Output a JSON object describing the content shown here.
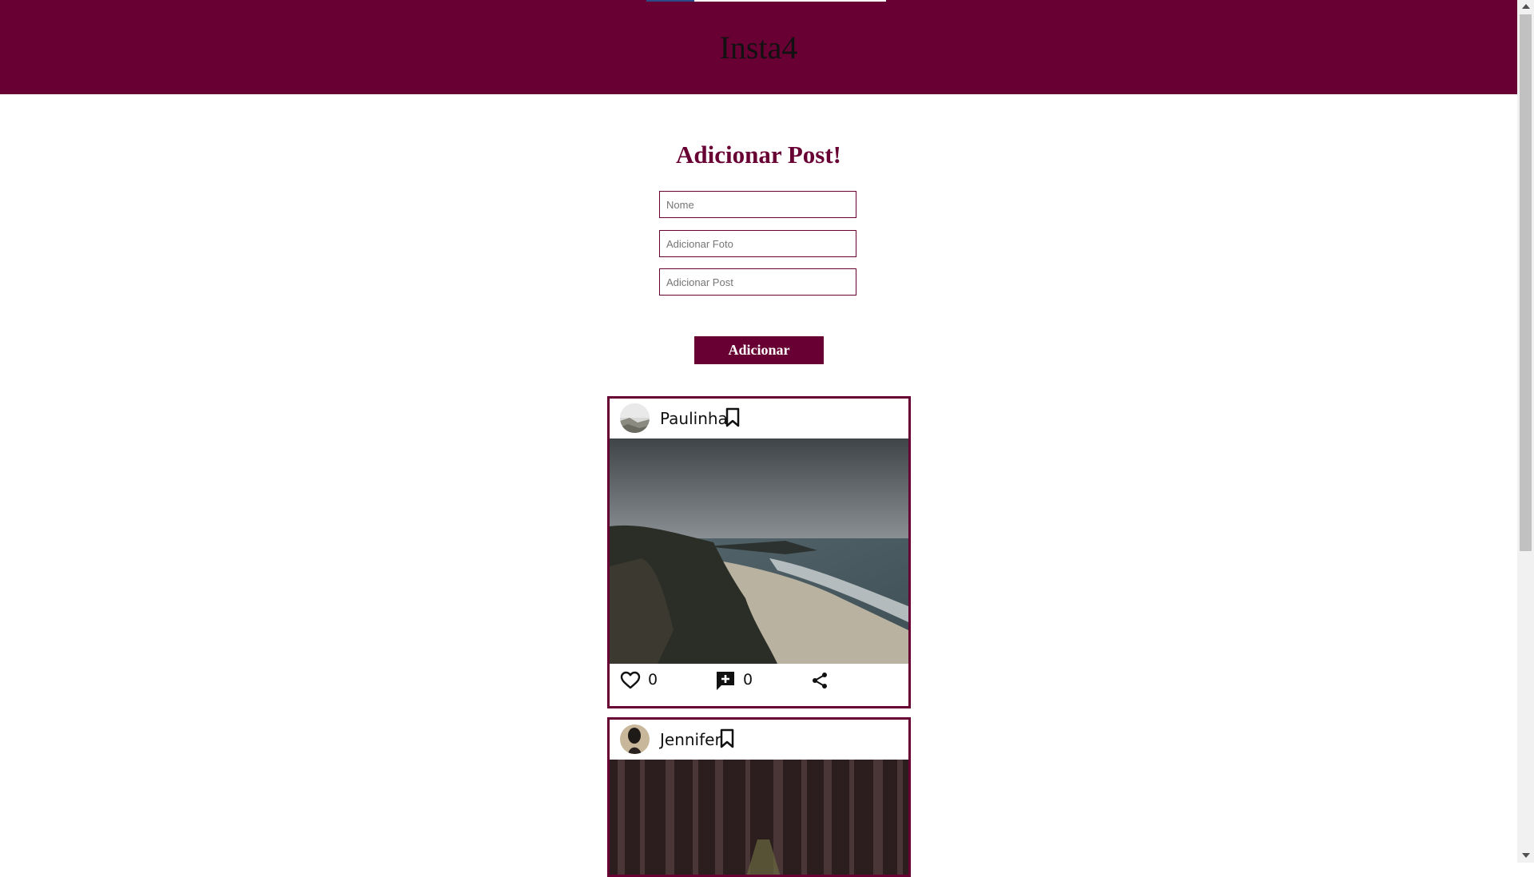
{
  "header": {
    "title": "Insta4"
  },
  "form": {
    "title": "Adicionar Post!",
    "name_placeholder": "Nome",
    "photo_placeholder": "Adicionar Foto",
    "post_placeholder": "Adicionar Post",
    "submit_label": "Adicionar"
  },
  "posts": [
    {
      "user": "Paulinha",
      "likes": "0",
      "comments": "0"
    },
    {
      "user": "Jennifer"
    }
  ],
  "icons": [
    "bookmark-icon",
    "heart-icon",
    "add-comment-icon",
    "share-icon"
  ],
  "colors": {
    "brand": "#680033"
  }
}
